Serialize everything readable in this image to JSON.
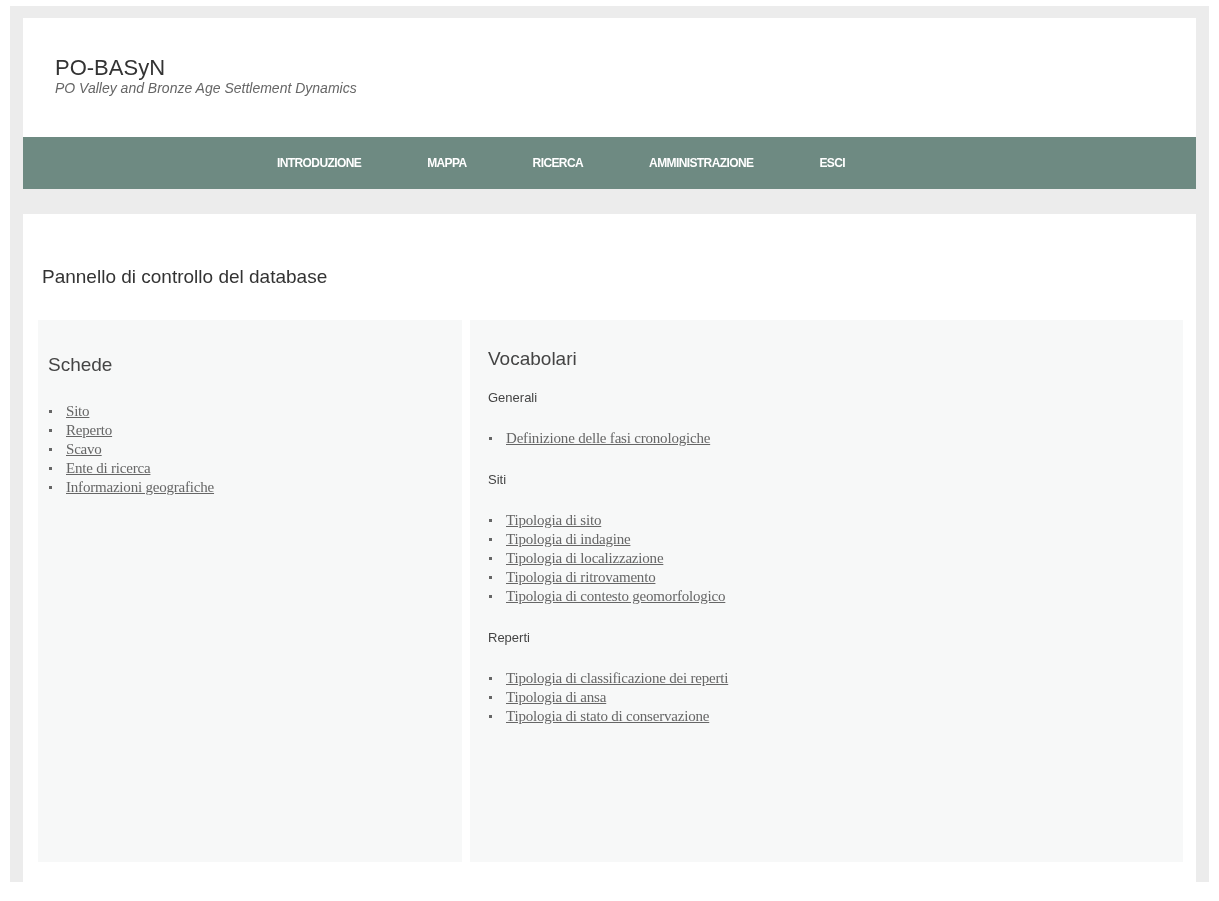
{
  "header": {
    "title": "PO-BASyN",
    "subtitle": "PO Valley and Bronze Age Settlement Dynamics"
  },
  "nav": [
    {
      "label": "INTRODUZIONE"
    },
    {
      "label": "MAPPA"
    },
    {
      "label": "RICERCA"
    },
    {
      "label": "AMMINISTRAZIONE"
    },
    {
      "label": "ESCI"
    }
  ],
  "page_title": "Pannello di controllo del database",
  "schede": {
    "heading": "Schede",
    "links": [
      "Sito",
      "Reperto",
      "Scavo",
      "Ente di ricerca",
      "Informazioni geografiche"
    ]
  },
  "vocabolari": {
    "heading": "Vocabolari",
    "groups": [
      {
        "title": "Generali",
        "links": [
          "Definizione delle fasi cronologiche"
        ]
      },
      {
        "title": "Siti",
        "links": [
          "Tipologia di sito",
          "Tipologia di indagine",
          "Tipologia di localizzazione",
          "Tipologia di ritrovamento",
          "Tipologia di contesto geomorfologico"
        ]
      },
      {
        "title": "Reperti",
        "links": [
          "Tipologia di classificazione dei reperti",
          "Tipologia di ansa",
          "Tipologia di stato di conservazione"
        ]
      }
    ]
  }
}
